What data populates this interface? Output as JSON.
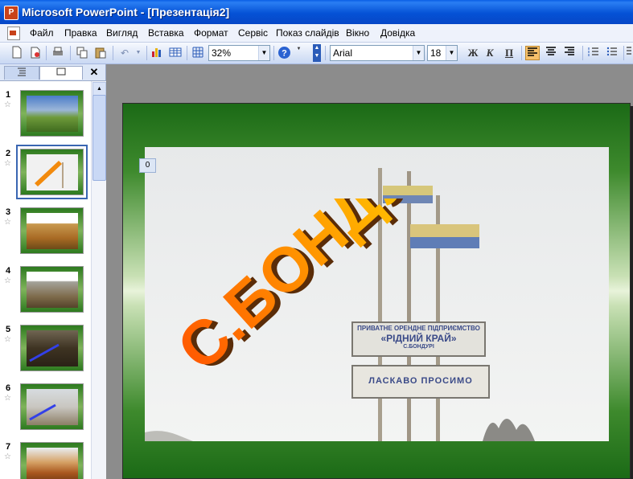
{
  "window": {
    "title": "Microsoft PowerPoint - [Презентація2]",
    "icon": "powerpoint-app-icon"
  },
  "menu": [
    "Файл",
    "Правка",
    "Вигляд",
    "Вставка",
    "Формат",
    "Сервіс",
    "Показ слайдів",
    "Вікно",
    "Довідка"
  ],
  "toolbar": {
    "zoom": "32%",
    "font": "Arial",
    "size": "18",
    "bold": "Ж",
    "italic": "К",
    "underline": "П",
    "align_left_active": true
  },
  "pane": {
    "tab_outline_icon": "outline-icon",
    "tab_slides_icon": "slides-icon",
    "close": "✕",
    "slides": [
      {
        "num": "1",
        "selected": false,
        "bg": "#5d9a3c"
      },
      {
        "num": "2",
        "selected": true,
        "bg": "#f1f1f1"
      },
      {
        "num": "3",
        "selected": false,
        "bg": "#b0772d"
      },
      {
        "num": "4",
        "selected": false,
        "bg": "#9c7a4f"
      },
      {
        "num": "5",
        "selected": false,
        "bg": "#3e3322"
      },
      {
        "num": "6",
        "selected": false,
        "bg": "#c9c6c0"
      },
      {
        "num": "7",
        "selected": false,
        "bg": "#a9571e"
      }
    ],
    "star": "☆"
  },
  "slide": {
    "tag": "0",
    "wordart": "С.БОНДУРІ",
    "sign1_line1": "ПРИВАТНЕ ОРЕНДНЕ ПІДПРИЄМСТВО",
    "sign1_line2": "«РІДНИЙ КРАЙ»",
    "sign1_line3": "С.БОНДУРІ",
    "sign2": "ЛАСКАВО ПРОСИМО"
  }
}
